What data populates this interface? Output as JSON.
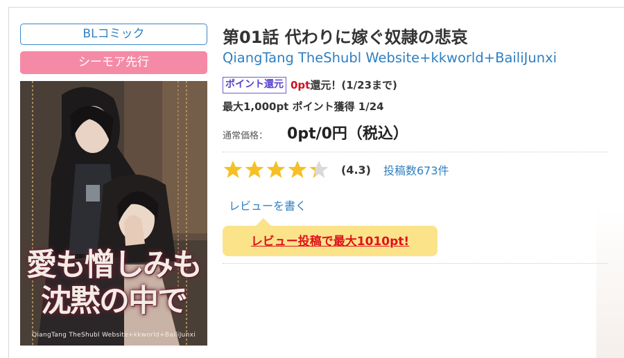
{
  "labels": {
    "genre": "BLコミック",
    "store": "シーモア先行"
  },
  "cover": {
    "title_line1": "愛も憎しみも",
    "title_line2": "沈黙の中で",
    "credit": "QiangTang TheShubl Website+kkworld+BailiJunxi"
  },
  "book": {
    "title": "第01話 代わりに嫁ぐ奴隷の悲哀",
    "authors": "QiangTang TheShubl Website+kkworld+BailiJunxi"
  },
  "points": {
    "badge": "ポイント還元",
    "amount": "0pt",
    "rest": "還元！(1/23まで)",
    "max_text": "最大1,000pt ポイント獲得 1/24"
  },
  "price": {
    "label": "通常価格：",
    "value": "0pt/0円（税込）"
  },
  "rating": {
    "value": 4.3,
    "display": "(4.3)",
    "count_text": "投稿数673件",
    "max_stars": 5,
    "star_color": "#f5c026",
    "star_empty_color": "#d9d9d9"
  },
  "review": {
    "write_link": "レビューを書く",
    "promo": "レビュー投稿で最大1010pt!"
  }
}
